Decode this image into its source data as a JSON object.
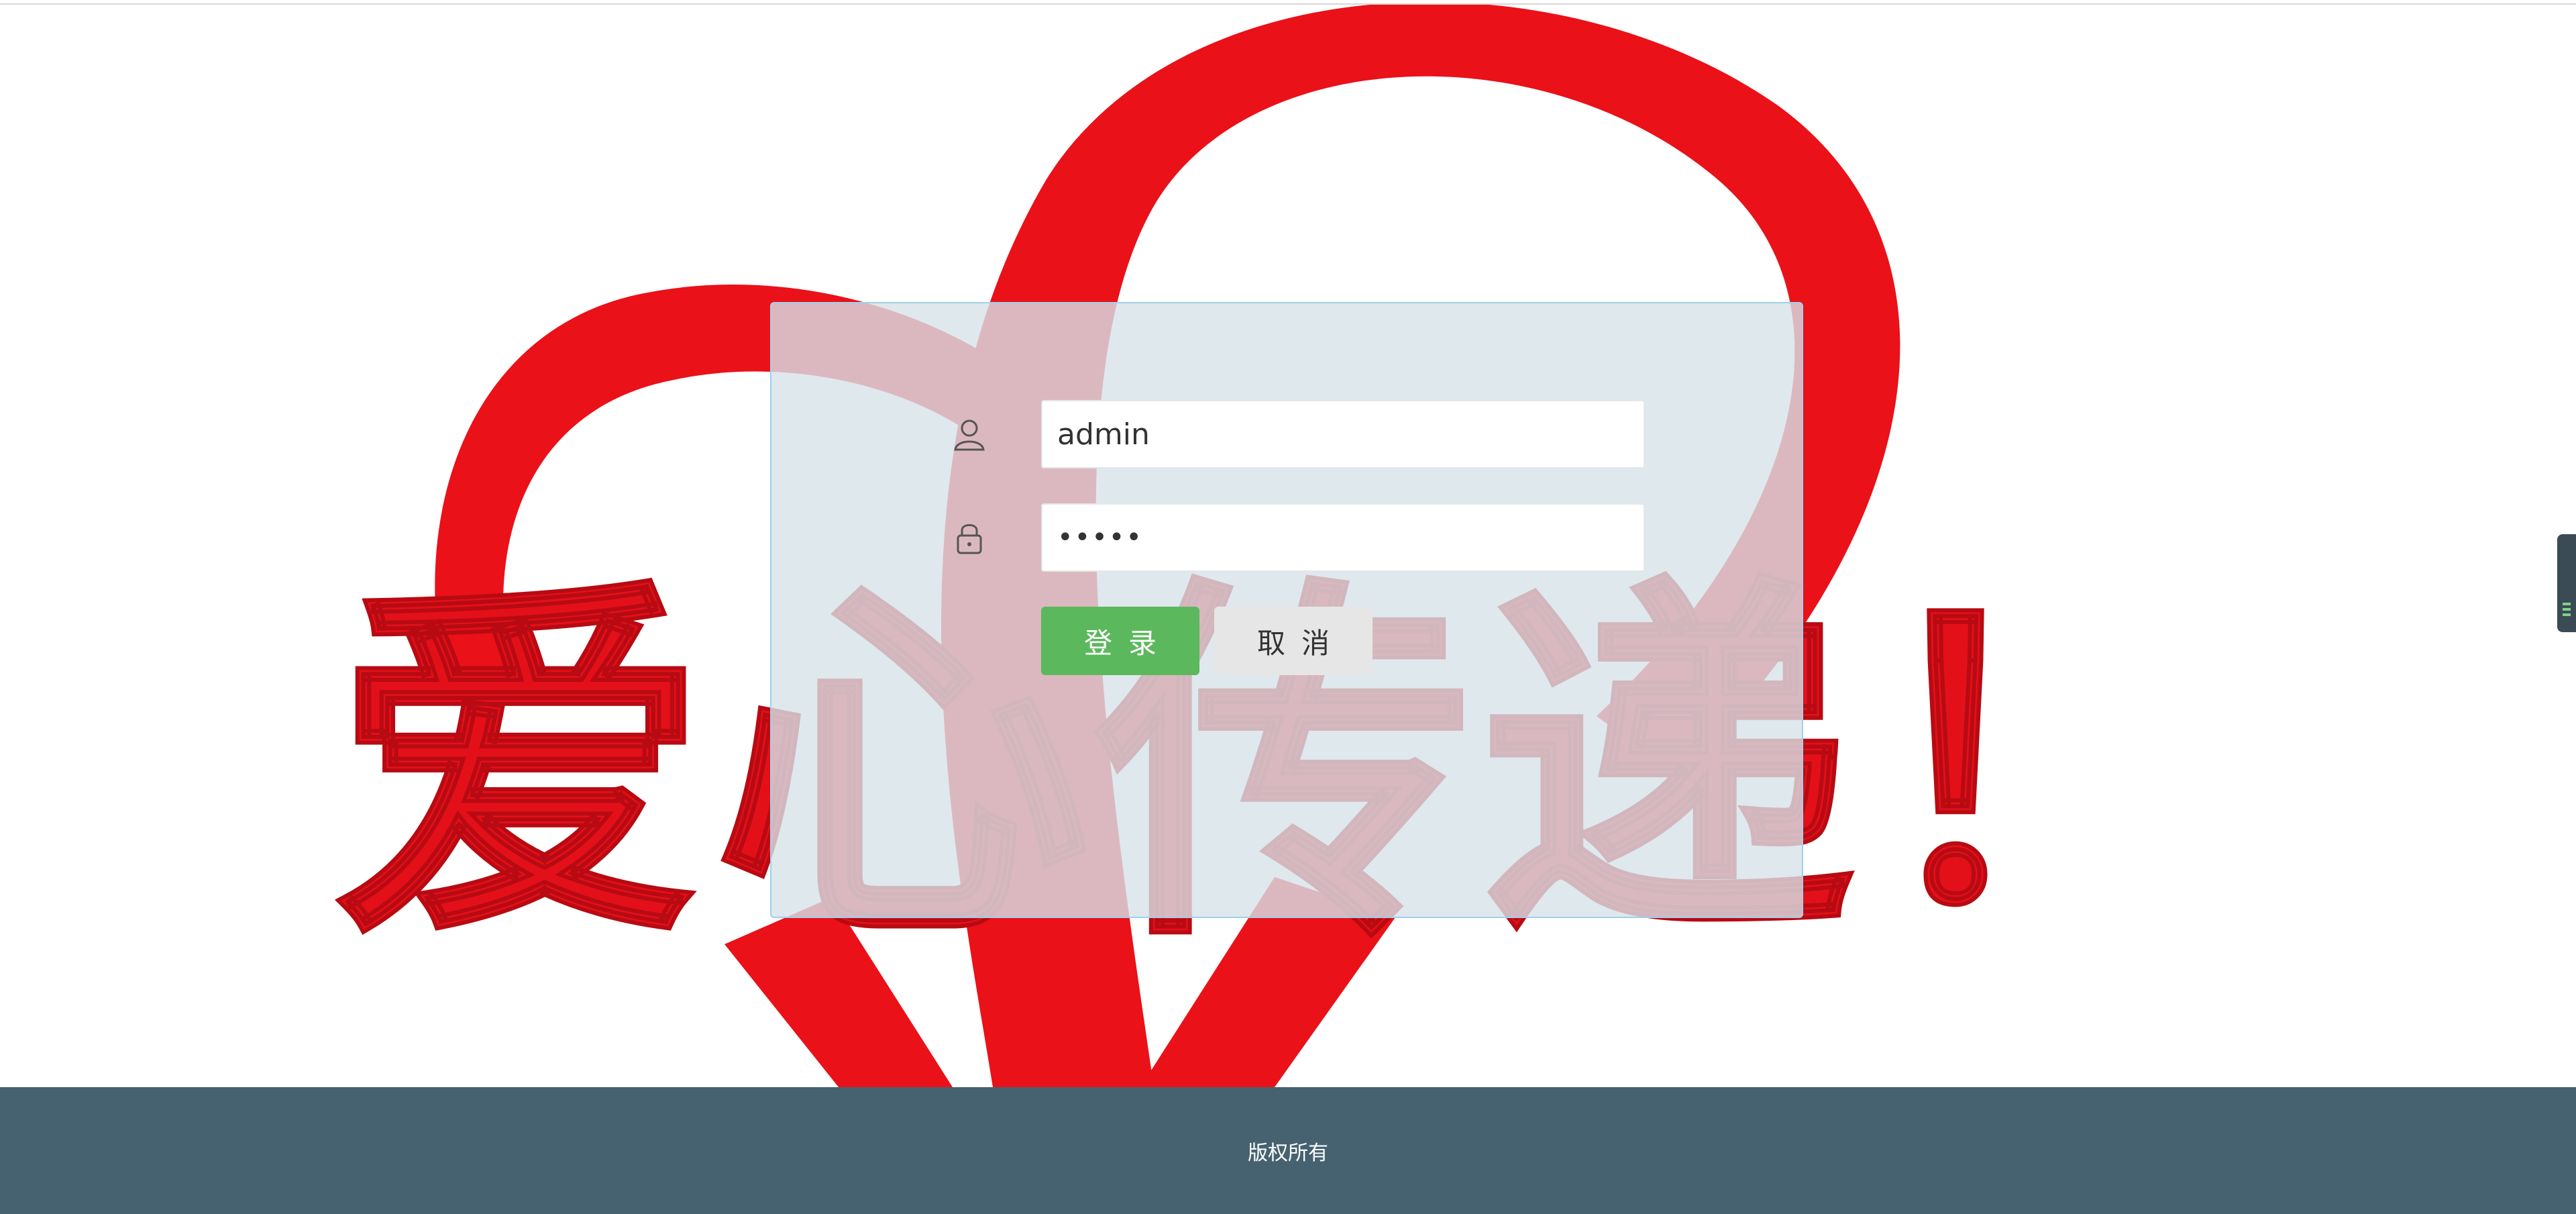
{
  "login": {
    "username_value": "admin",
    "password_value": "•••••",
    "login_label": "登录",
    "cancel_label": "取消"
  },
  "hero": {
    "slogan": "爱心传递！",
    "accent_color": "#e3101a"
  },
  "footer": {
    "text": "版权所有",
    "background_color": "#466271"
  },
  "icons": {
    "username": "user-icon",
    "password": "lock-icon",
    "side_handle": "side-toolbar-handle"
  },
  "colors": {
    "login_button": "#5cb85c",
    "cancel_button": "#e6e6e6",
    "panel_border": "#9fd0ec"
  }
}
